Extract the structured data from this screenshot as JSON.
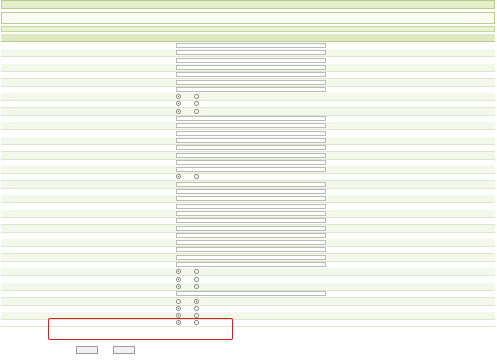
{
  "window": {
    "title": ""
  },
  "menu": {
    "tabs": [
      "",
      "",
      "",
      "",
      "",
      "",
      "",
      "",
      ""
    ]
  },
  "table": {
    "header": {
      "name_col": "",
      "value_col": "",
      "var_col": ""
    }
  },
  "rows": [
    {
      "label": "",
      "type": "text",
      "value": "",
      "var": ""
    },
    {
      "label": "",
      "type": "text",
      "value": "",
      "var": ""
    },
    {
      "label": "",
      "type": "text",
      "value": "",
      "var": ""
    },
    {
      "label": "",
      "type": "text",
      "value": "",
      "var": ""
    },
    {
      "label": "",
      "type": "text",
      "value": "",
      "var": ""
    },
    {
      "label": "",
      "type": "text",
      "value": "",
      "var": ""
    },
    {
      "label": "",
      "type": "text",
      "value": "",
      "var": ""
    },
    {
      "label": "",
      "type": "radio",
      "value": "yes",
      "var": ""
    },
    {
      "label": "",
      "type": "radio",
      "value": "yes",
      "var": ""
    },
    {
      "label": "",
      "type": "radio",
      "value": "yes",
      "var": ""
    },
    {
      "label": "",
      "type": "text",
      "value": "",
      "var": ""
    },
    {
      "label": "",
      "type": "text",
      "value": "",
      "var": ""
    },
    {
      "label": "",
      "type": "text",
      "value": "",
      "var": ""
    },
    {
      "label": "",
      "type": "text",
      "value": "",
      "var": ""
    },
    {
      "label": "",
      "type": "text",
      "value": "",
      "var": ""
    },
    {
      "label": "",
      "type": "text",
      "value": "",
      "var": ""
    },
    {
      "label": "",
      "type": "text",
      "value": "",
      "var": ""
    },
    {
      "label": "",
      "type": "text",
      "value": "",
      "var": ""
    },
    {
      "label": "",
      "type": "radio",
      "value": "yes",
      "var": ""
    },
    {
      "label": "",
      "type": "text",
      "value": "",
      "var": ""
    },
    {
      "label": "",
      "type": "text",
      "value": "",
      "var": ""
    },
    {
      "label": "",
      "type": "text",
      "value": "",
      "var": ""
    },
    {
      "label": "",
      "type": "text",
      "value": "",
      "var": ""
    },
    {
      "label": "",
      "type": "text",
      "value": "",
      "var": ""
    },
    {
      "label": "",
      "type": "text",
      "value": "",
      "var": ""
    },
    {
      "label": "",
      "type": "text",
      "value": "",
      "var": ""
    },
    {
      "label": "",
      "type": "text",
      "value": "",
      "var": ""
    },
    {
      "label": "",
      "type": "text",
      "value": "",
      "var": ""
    },
    {
      "label": "",
      "type": "text",
      "value": "",
      "var": ""
    },
    {
      "label": "",
      "type": "text",
      "value": "",
      "var": ""
    },
    {
      "label": "",
      "type": "text",
      "value": "",
      "var": ""
    },
    {
      "label": "",
      "type": "radio",
      "value": "yes",
      "var": ""
    },
    {
      "label": "",
      "type": "radio",
      "value": "yes",
      "var": ""
    },
    {
      "label": "",
      "type": "radio",
      "value": "yes",
      "var": ""
    },
    {
      "label": "",
      "type": "text",
      "value": "",
      "var": ""
    },
    {
      "label": "",
      "type": "radio",
      "value": "no",
      "var": ""
    },
    {
      "label": "",
      "type": "radio",
      "value": "yes",
      "var": ""
    },
    {
      "label": "",
      "type": "radio",
      "value": "yes",
      "var": ""
    },
    {
      "label": "",
      "type": "radio",
      "value": "yes",
      "var": ""
    }
  ],
  "radio_labels": {
    "yes": "",
    "no": ""
  },
  "buttons": {
    "save": "",
    "reset": ""
  },
  "watermark": {
    "main": "",
    "sub": ""
  },
  "colors": {
    "header_bg": "#dfe9c3",
    "border": "#b9cc8a",
    "highlight": "#d92020"
  }
}
